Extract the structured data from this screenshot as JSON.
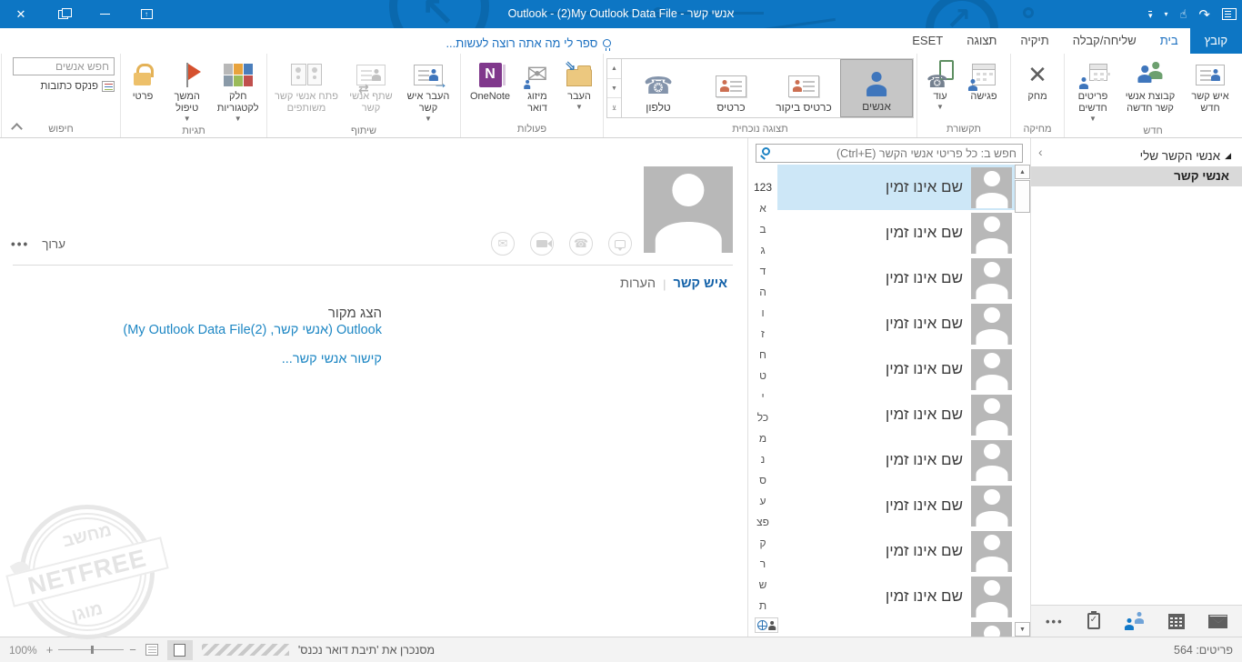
{
  "titlebar": {
    "title": "Outlook - (2)My Outlook Data File - אנשי קשר"
  },
  "tabs": {
    "file": "קובץ",
    "home": "בית",
    "send_receive": "שליחה/קבלה",
    "folder": "תיקיה",
    "view": "תצוגה",
    "eset": "ESET",
    "tell_me": "ספר לי מה אתה רוצה לעשות..."
  },
  "ribbon": {
    "new_group": {
      "label": "חדש",
      "new_contact": "איש קשר חדש",
      "new_contact_group": "קבוצת אנשי קשר חדשה",
      "new_items": "פריטים חדשים"
    },
    "delete_group": {
      "label": "מחיקה",
      "delete": "מחק"
    },
    "communicate_group": {
      "label": "תקשורת",
      "meeting": "פגישה",
      "more": "עוד"
    },
    "current_view_group": {
      "label": "תצוגה נוכחית",
      "people": "אנשים",
      "business_card": "כרטיס ביקור",
      "card": "כרטיס",
      "phone": "טלפון"
    },
    "actions_group": {
      "label": "פעולות",
      "move": "העבר",
      "mail_merge": "מיזוג דואר",
      "onenote": "OneNote"
    },
    "share_group": {
      "label": "שיתוף",
      "forward_contact": "העבר איש קשר",
      "share_contacts": "שתף אנשי קשר",
      "open_shared_contacts": "פתח אנשי קשר משותפים"
    },
    "tags_group": {
      "label": "תגיות",
      "categorize": "חלק לקטגוריות",
      "follow_up": "המשך טיפול",
      "private": "פרטי"
    },
    "find_group": {
      "label": "חיפוש",
      "search_placeholder": "חפש אנשים",
      "address_book": "פנקס כתובות"
    }
  },
  "folder_pane": {
    "header": "אנשי הקשר שלי",
    "selected_folder": "אנשי קשר"
  },
  "contact_list": {
    "search_placeholder": "חפש ב: כל פריטי אנשי הקשר (Ctrl+E)",
    "alphabet": [
      "123",
      "א",
      "ב",
      "ג",
      "ד",
      "ה",
      "ו",
      "ז",
      "ח",
      "ט",
      "י",
      "כל",
      "מ",
      "נ",
      "ס",
      "ע",
      "פצ",
      "ק",
      "ר",
      "ש",
      "ת"
    ],
    "contacts": [
      {
        "name": "שם אינו זמין"
      },
      {
        "name": "שם אינו זמין"
      },
      {
        "name": "שם אינו זמין"
      },
      {
        "name": "שם אינו זמין"
      },
      {
        "name": "שם אינו זמין"
      },
      {
        "name": "שם אינו זמין"
      },
      {
        "name": "שם אינו זמין"
      },
      {
        "name": "שם אינו זמין"
      },
      {
        "name": "שם אינו זמין"
      },
      {
        "name": "שם אינו זמין"
      }
    ]
  },
  "reading_pane": {
    "edit": "ערוך",
    "tab_contact": "איש קשר",
    "tab_notes": "הערות",
    "source_heading": "הצג מקור",
    "source_link": "Outlook (אנשי קשר, My Outlook Data File(2))",
    "link_contacts": "קישור אנשי קשר..."
  },
  "watermark": {
    "top": "מחשב",
    "middle": "NETFREE",
    "bottom": "מוגן"
  },
  "status_bar": {
    "zoom_level": "100%",
    "sync_status": "מסנכרן את 'תיבת דואר נכנס'",
    "item_count": "פריטים: 564"
  },
  "colors": {
    "titlebar_blue": "#0d76c4",
    "accent_blue": "#1a6fc0",
    "link_blue": "#1e87c4",
    "selection_blue": "#cde7f7",
    "avatar_gray": "#b8b8b8"
  }
}
